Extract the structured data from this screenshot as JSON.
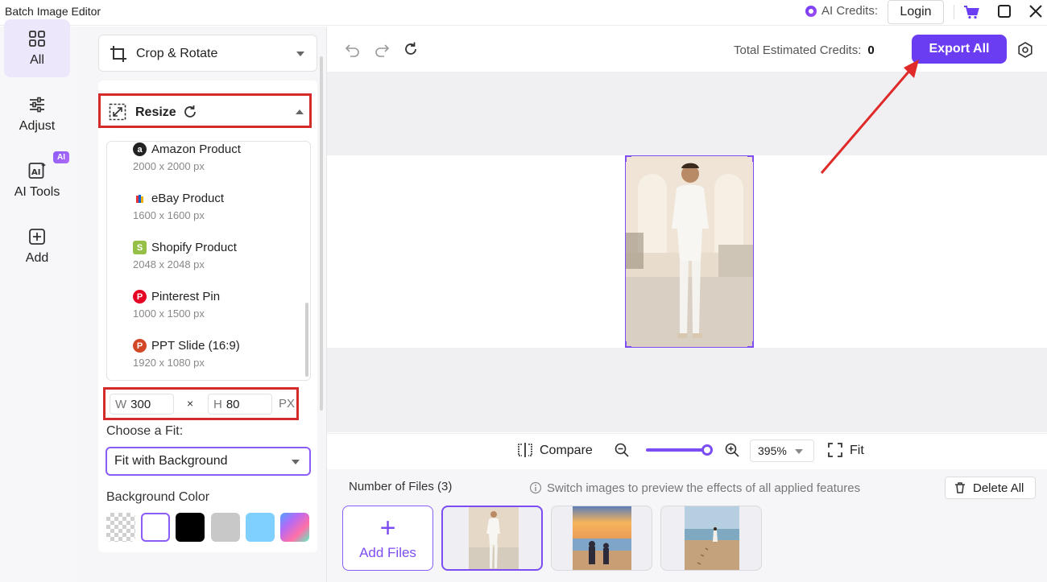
{
  "titlebar": {
    "app_title": "Batch Image Editor",
    "credits_label": "AI Credits:",
    "login_label": "Login"
  },
  "nav": {
    "items": [
      {
        "label": "All",
        "icon": "grid-icon",
        "active": true
      },
      {
        "label": "Adjust",
        "icon": "sliders-icon",
        "active": false
      },
      {
        "label": "AI Tools",
        "icon": "ai-tools-icon",
        "active": false,
        "badge": "AI"
      },
      {
        "label": "Add",
        "icon": "plus-square-icon",
        "active": false
      }
    ]
  },
  "panel": {
    "crop_rotate_label": "Crop & Rotate",
    "resize_label": "Resize",
    "presets": [
      {
        "name": "Amazon Product",
        "size": "2000 x 2000 px",
        "icon": "amazon-icon",
        "color": "#222222"
      },
      {
        "name": "eBay Product",
        "size": "1600 x 1600 px",
        "icon": "ebay-icon",
        "color": "#e53238"
      },
      {
        "name": "Shopify Product",
        "size": "2048 x 2048 px",
        "icon": "shopify-icon",
        "color": "#95bf47"
      },
      {
        "name": "Pinterest Pin",
        "size": "1000 x 1500 px",
        "icon": "pinterest-icon",
        "color": "#e60023"
      },
      {
        "name": "PPT Slide (16:9)",
        "size": "1920 x 1080 px",
        "icon": "powerpoint-icon",
        "color": "#d24726"
      }
    ],
    "width_label": "W",
    "width_value": "300",
    "times_sign": "×",
    "height_label": "H",
    "height_value": "80",
    "unit": "PX",
    "fit_label": "Choose a Fit:",
    "fit_value": "Fit with Background",
    "bg_color_label": "Background Color",
    "bg_colors": [
      "transparent",
      "#ffffff",
      "#000000",
      "#c8c8c8",
      "#7fd0ff",
      "gradient"
    ],
    "selected_bg": "#ffffff"
  },
  "toolbar": {
    "est_credits_label": "Total Estimated Credits:",
    "est_credits_value": "0",
    "export_label": "Export All"
  },
  "canvas": {
    "compare_label": "Compare",
    "zoom_level": 0.95,
    "zoom_value": "395%",
    "fit_label": "Fit"
  },
  "files": {
    "count_label": "Number of Files (3)",
    "hint": "Switch images to preview the effects of all applied features",
    "delete_all_label": "Delete All",
    "add_files_label": "Add Files",
    "thumbnails": [
      "man-in-white-suit",
      "kids-at-sunset-beach",
      "girl-on-beach"
    ]
  },
  "colors": {
    "accent": "#6a3cf2",
    "highlight_red": "#d32a2a"
  }
}
